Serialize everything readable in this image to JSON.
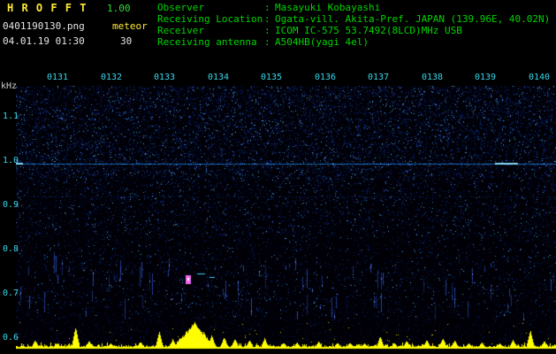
{
  "app": {
    "title": "H R O F F T",
    "version": "1.00",
    "filename": "0401190130.png",
    "mode": "meteor",
    "datetime": "04.01.19 01:30",
    "count": "30"
  },
  "station": {
    "separator": ":",
    "rows": [
      {
        "label": "Observer",
        "value": "Masayuki Kobayashi"
      },
      {
        "label": "Receiving Location",
        "value": "Ogata-vill. Akita-Pref. JAPAN (139.96E, 40.02N)"
      },
      {
        "label": "Receiver",
        "value": "ICOM IC-575 53.7492(8LCD)MHz USB"
      },
      {
        "label": "Receiving antenna",
        "value": "A504HB(yagi 4el)"
      }
    ]
  },
  "axis": {
    "unit": "kHz",
    "freq_ticks": [
      "1.1",
      "1.0",
      "0.9",
      "0.8",
      "0.7",
      "0.6"
    ],
    "time_ticks": [
      "0131",
      "0132",
      "0133",
      "0134",
      "0135",
      "0136",
      "0137",
      "0138",
      "0139",
      "0140"
    ]
  },
  "colors": {
    "background": "#000000",
    "header_green": "#00d400",
    "title_yellow": "#ffe933",
    "axis_cyan": "#38d6ea",
    "noise_blue": "#1e50c8",
    "signal_yellow": "#ffff00"
  },
  "chart_data": [
    {
      "type": "heatmap",
      "name": "meteor-echo-spectrogram",
      "x_ticks": [
        "0131",
        "0132",
        "0133",
        "0134",
        "0135",
        "0136",
        "0137",
        "0138",
        "0139",
        "0140"
      ],
      "y_unit": "kHz",
      "y_ticks": [
        1.1,
        1.0,
        0.9,
        0.8,
        0.7,
        0.6
      ],
      "y_range": [
        0.58,
        1.17
      ],
      "background": "sparse blue noise speckle on near-black, denser at higher frequencies",
      "features": [
        {
          "kind": "carrier-line",
          "freq_khz": 0.992,
          "span": "full-width",
          "color": "#2896ff"
        },
        {
          "kind": "faint-line",
          "freq_khz": 0.918,
          "span": "full-width",
          "color": "#1e50c8"
        },
        {
          "kind": "meteor-echo",
          "time": "0133.4",
          "x_frac": 0.319,
          "freq_khz": 0.73,
          "color": "#ee66ee"
        },
        {
          "kind": "echo-dashes",
          "time": "0133.5",
          "x_frac": 0.335,
          "freq_khz": 0.737,
          "color": "#44ccff"
        }
      ]
    },
    {
      "type": "area",
      "name": "signal-level",
      "color": "#ffff00",
      "baseline_frac": 0.08,
      "spikes": [
        {
          "x": 0.035,
          "h": 0.3
        },
        {
          "x": 0.075,
          "h": 0.2
        },
        {
          "x": 0.11,
          "h": 0.8
        },
        {
          "x": 0.135,
          "h": 0.28
        },
        {
          "x": 0.175,
          "h": 0.2
        },
        {
          "x": 0.23,
          "h": 0.25
        },
        {
          "x": 0.265,
          "h": 0.62
        },
        {
          "x": 0.29,
          "h": 0.35
        },
        {
          "x": 0.33,
          "h": 1.0,
          "w": 0.045
        },
        {
          "x": 0.362,
          "h": 0.5
        },
        {
          "x": 0.385,
          "h": 0.42
        },
        {
          "x": 0.405,
          "h": 0.35
        },
        {
          "x": 0.432,
          "h": 0.3
        },
        {
          "x": 0.46,
          "h": 0.38
        },
        {
          "x": 0.495,
          "h": 0.22
        },
        {
          "x": 0.52,
          "h": 0.22
        },
        {
          "x": 0.56,
          "h": 0.25
        },
        {
          "x": 0.595,
          "h": 0.2
        },
        {
          "x": 0.618,
          "h": 0.2
        },
        {
          "x": 0.645,
          "h": 0.18
        },
        {
          "x": 0.674,
          "h": 0.45
        },
        {
          "x": 0.7,
          "h": 0.2
        },
        {
          "x": 0.723,
          "h": 0.28
        },
        {
          "x": 0.76,
          "h": 0.32
        },
        {
          "x": 0.79,
          "h": 0.38
        },
        {
          "x": 0.812,
          "h": 0.3
        },
        {
          "x": 0.838,
          "h": 0.2
        },
        {
          "x": 0.862,
          "h": 0.22
        },
        {
          "x": 0.895,
          "h": 0.2
        },
        {
          "x": 0.92,
          "h": 0.32
        },
        {
          "x": 0.952,
          "h": 0.68
        },
        {
          "x": 0.978,
          "h": 0.28
        }
      ]
    }
  ]
}
